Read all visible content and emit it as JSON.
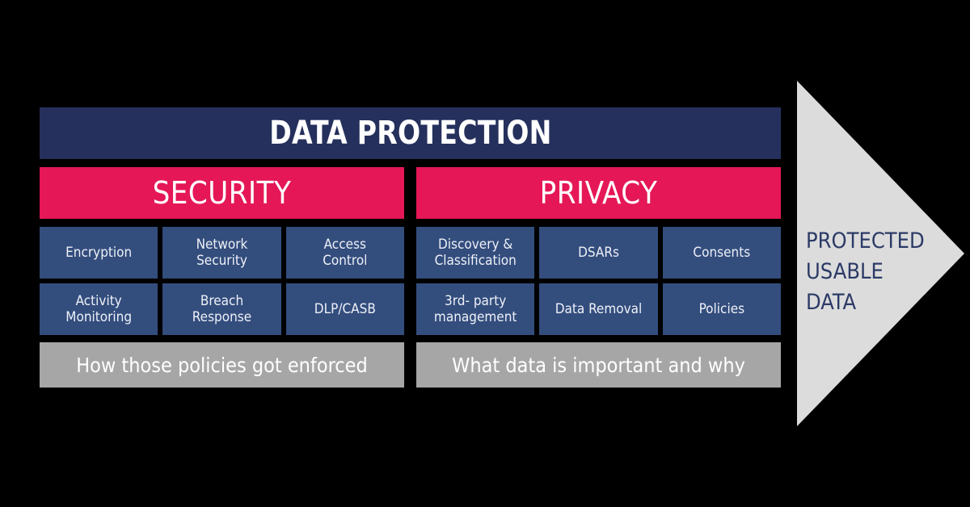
{
  "header": {
    "title": "DATA PROTECTION"
  },
  "columns": [
    {
      "key": "security",
      "pillar": "SECURITY",
      "tiles_row1": [
        "Encryption",
        "Network\nSecurity",
        "Access\nControl"
      ],
      "tiles_row2": [
        "Activity\nMonitoring",
        "Breach\nResponse",
        "DLP/CASB"
      ],
      "caption": "How those policies got enforced"
    },
    {
      "key": "privacy",
      "pillar": "PRIVACY",
      "tiles_row1": [
        "Discovery &\nClassification",
        "DSARs",
        "Consents"
      ],
      "tiles_row2": [
        "3rd- party\nmanagement",
        "Data Removal",
        "Policies"
      ],
      "caption": "What data is important and why"
    }
  ],
  "arrow": {
    "lines": [
      "PROTECTED",
      "USABLE",
      "DATA"
    ],
    "shape": "right-pointing-triangle"
  },
  "colors": {
    "background": "#000000",
    "header_navy": "#25305c",
    "pillar_crimson": "#e51757",
    "tile_blue": "#334d7d",
    "caption_gray": "#a6a6a6",
    "arrow_gray": "#dcdcdc",
    "arrow_text_navy": "#2b3a66",
    "text_white": "#ffffff"
  }
}
